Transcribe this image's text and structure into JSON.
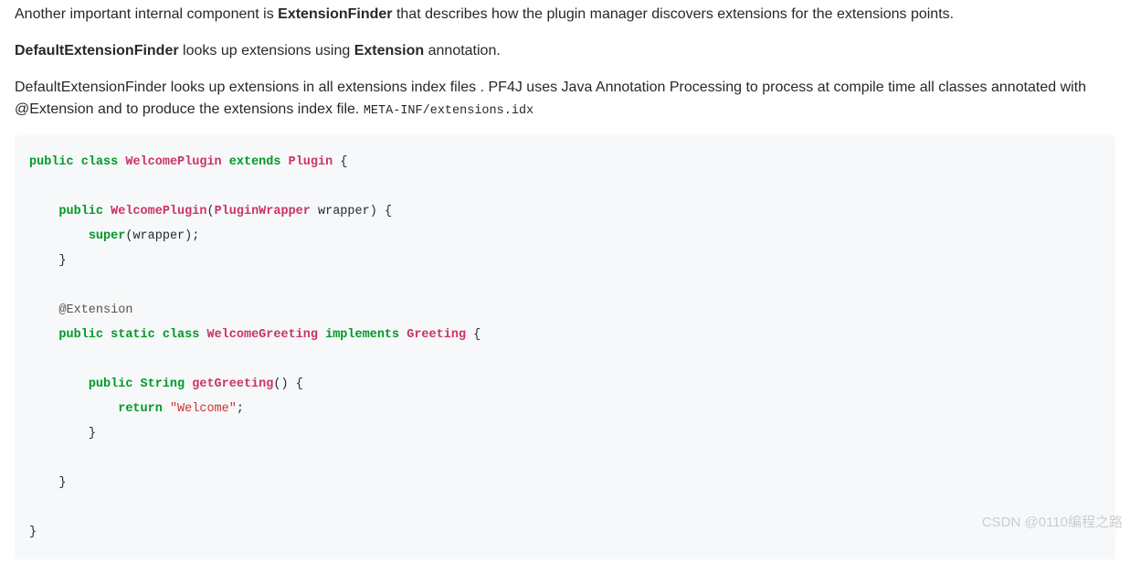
{
  "para1": {
    "t1": "Another important internal component is ",
    "bold": "ExtensionFinder",
    "t2": " that describes how the plugin manager discovers extensions for the extensions points."
  },
  "para2": {
    "bold1": "DefaultExtensionFinder",
    "t1": " looks up extensions using ",
    "bold2": "Extension",
    "t2": " annotation."
  },
  "para3": {
    "t1": "DefaultExtensionFinder looks up extensions in all extensions index files . PF4J uses Java Annotation Processing to process at compile time all classes annotated with @Extension and to produce the extensions index file. ",
    "code": "META-INF/extensions.idx"
  },
  "code": {
    "kw_public": "public",
    "kw_class": "class",
    "kw_extends": "extends",
    "kw_static": "static",
    "kw_implements": "implements",
    "kw_return": "return",
    "kw_super": "super",
    "cl_welcomeplugin": "WelcomePlugin",
    "cl_plugin": "Plugin",
    "cl_pluginwrapper": "PluginWrapper",
    "cl_welcomegreeting": "WelcomeGreeting",
    "cl_greeting": "Greeting",
    "ty_string": "String",
    "fn_getgreeting": "getGreeting",
    "id_wrapper": "wrapper",
    "ann_extension": "@Extension",
    "str_welcome": "\"Welcome\"",
    "lbrace": "{",
    "rbrace": "}",
    "lpar": "(",
    "rpar": ")",
    "semi": ";",
    "sp": " "
  },
  "watermark": "CSDN @0110编程之路"
}
